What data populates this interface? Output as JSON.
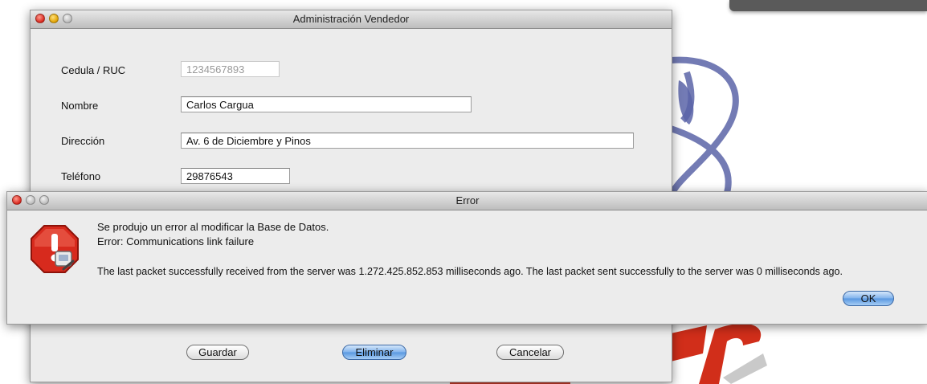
{
  "vendor_window": {
    "title": "Administración Vendedor",
    "fields": {
      "cedula_label": "Cedula / RUC",
      "cedula_value": "1234567893",
      "nombre_label": "Nombre",
      "nombre_value": "Carlos Cargua",
      "direccion_label": "Dirección",
      "direccion_value": "Av. 6 de Diciembre y Pinos",
      "telefono_label": "Teléfono",
      "telefono_value": "29876543"
    },
    "buttons": {
      "save": "Guardar",
      "delete": "Eliminar",
      "cancel": "Cancelar"
    }
  },
  "error_dialog": {
    "title": "Error",
    "line1": "Se produjo un error al modificar la Base de Datos.",
    "line2": "Error: Communications link failure",
    "line3": "The last packet successfully received from the server was 1.272.425.852.853 milliseconds ago.  The last packet sent successfully to the server was 0 milliseconds ago.",
    "ok_label": "OK",
    "icon": "stop-alert-icon"
  },
  "colors": {
    "background_art_blue": "#5a63a6",
    "background_art_red": "#d0301a"
  }
}
